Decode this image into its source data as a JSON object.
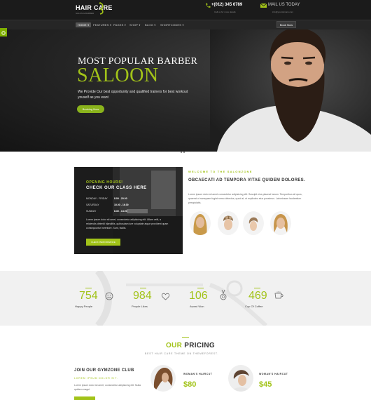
{
  "header": {
    "logo": "HAIR CARE",
    "logo_tagline": "SALON & BARBER",
    "phone": "+(012) 345 6789",
    "phone_sub": "Call us for more details",
    "mail": "MAIL US TODAY",
    "mail_sub": "info@yourdomain.com"
  },
  "nav": {
    "items": [
      "HOME",
      "FEATURES",
      "PAGES",
      "SHOP",
      "BLOG",
      "SHORTCODES"
    ],
    "book_label": "Book Now"
  },
  "hero": {
    "headline": "MOST POPULAR BARBER",
    "big": "SALOON",
    "desc": "We Provide Our best opportunity and qualified trainers for best workout youself as you want",
    "button": "Booking Now"
  },
  "hours": {
    "title": "OPENING HOURS!",
    "subtitle": "CHECK OUR CLASS HERE",
    "rows": [
      {
        "day": "MONDAY - FRIDAY",
        "time": "8.00 - 20.00"
      },
      {
        "day": "SATURDAY",
        "time": "10.00 - 16.00"
      },
      {
        "day": "SUNDAY",
        "time": "8.30 - 14.00"
      }
    ],
    "text": "Lorem ipsum dolor sit amet, consectetur adipisicing elit. Ullam velit, a reiciendis deleniti blanditiis, quibusdam iure voluptate atque provident quam consequuntur inventore. Sunt, facilis.",
    "button": "CHECK PERFORMANCE"
  },
  "welcome": {
    "kicker": "WELCOME TO THE SALONZONE",
    "title": "OBCAECATI AD TEMPORA VITAE QUIDEM DOLORES.",
    "body": "Lorem ipsum dolor sit amet consectetur adipisicing elit. Suscipit eius placeat harum. Temporibus sit quos, quaerat ut numquam fugiat nemo delectus, quod at, ut explicabo eius possimus. Laboriosam laudantium perspiciatis."
  },
  "counters": [
    {
      "value": "754",
      "label": "Happy People",
      "icon": "smiley-icon"
    },
    {
      "value": "984",
      "label": "People Likes",
      "icon": "heart-icon"
    },
    {
      "value": "106",
      "label": "Award Won",
      "icon": "medal-icon"
    },
    {
      "value": "469",
      "label": "Cup Of Coffee",
      "icon": "coffee-cup-icon"
    }
  ],
  "pricing": {
    "title_highlight": "OUR",
    "title_rest": "PRICING",
    "subtitle": "BEST HAIR CARE THEME ON THEMEFOREST.",
    "club_title": "JOIN OUR GYMZONE CLUB",
    "club_kicker": "LOREM IPSUM DOLOR SIT.",
    "club_body": "Lorem ipsum dolor sit amet, consectetur adipisicing elit. Nulla quidem magni.",
    "items": [
      {
        "label": "WOMAN'S HAIRCUT",
        "price": "$80"
      },
      {
        "label": "WOMAN'S HAIRCUT",
        "price": "$45"
      }
    ]
  },
  "colors": {
    "accent": "#a2c319",
    "dark": "#1b1b1b"
  }
}
